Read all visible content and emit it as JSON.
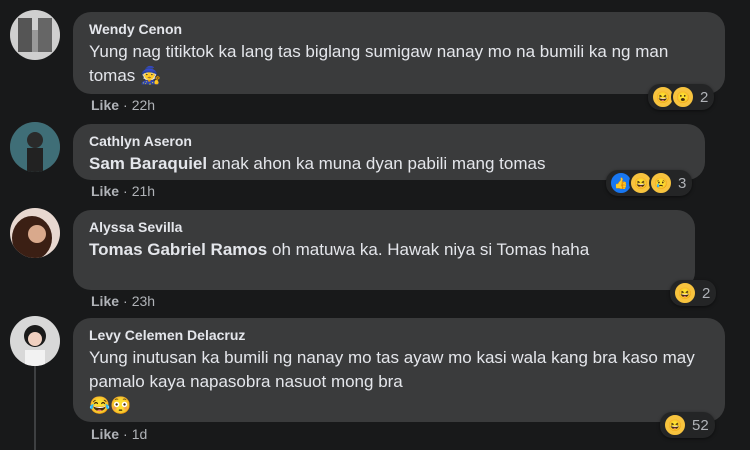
{
  "comments": [
    {
      "name": "Wendy Cenon",
      "text": "Yung nag titiktok ka lang tas biglang sumigaw nanay mo na bumili ka ng man tomas",
      "trailing_emoji": "🧙",
      "like_label": "Like",
      "time": "22h",
      "reaction_icons": [
        "haha-icon",
        "wow-icon"
      ],
      "reaction_count": "2"
    },
    {
      "name": "Cathlyn Aseron",
      "mention": "Sam Baraquiel",
      "text": "anak ahon ka muna dyan pabili mang tomas",
      "like_label": "Like",
      "time": "21h",
      "reaction_icons": [
        "like-icon",
        "haha-icon",
        "sad-icon"
      ],
      "reaction_count": "3"
    },
    {
      "name": "Alyssa Sevilla",
      "mention": "Tomas Gabriel Ramos",
      "text": "oh matuwa ka. Hawak niya si Tomas haha",
      "like_label": "Like",
      "time": "23h",
      "reaction_icons": [
        "haha-icon"
      ],
      "reaction_count": "2"
    },
    {
      "name": "Levy Celemen Delacruz",
      "text": "Yung inutusan ka bumili ng nanay mo tas ayaw mo kasi wala kang bra kaso may pamalo kaya napasobra nasuot mong bra",
      "trailing_emoji": "😂😳",
      "like_label": "Like",
      "time": "1d",
      "reaction_icons": [
        "haha-icon"
      ],
      "reaction_count": "52"
    }
  ],
  "separator": "·",
  "colors": {
    "background": "#18191a",
    "bubble": "#3a3b3c",
    "muted": "#b0b3b8",
    "text": "#e4e6eb"
  }
}
